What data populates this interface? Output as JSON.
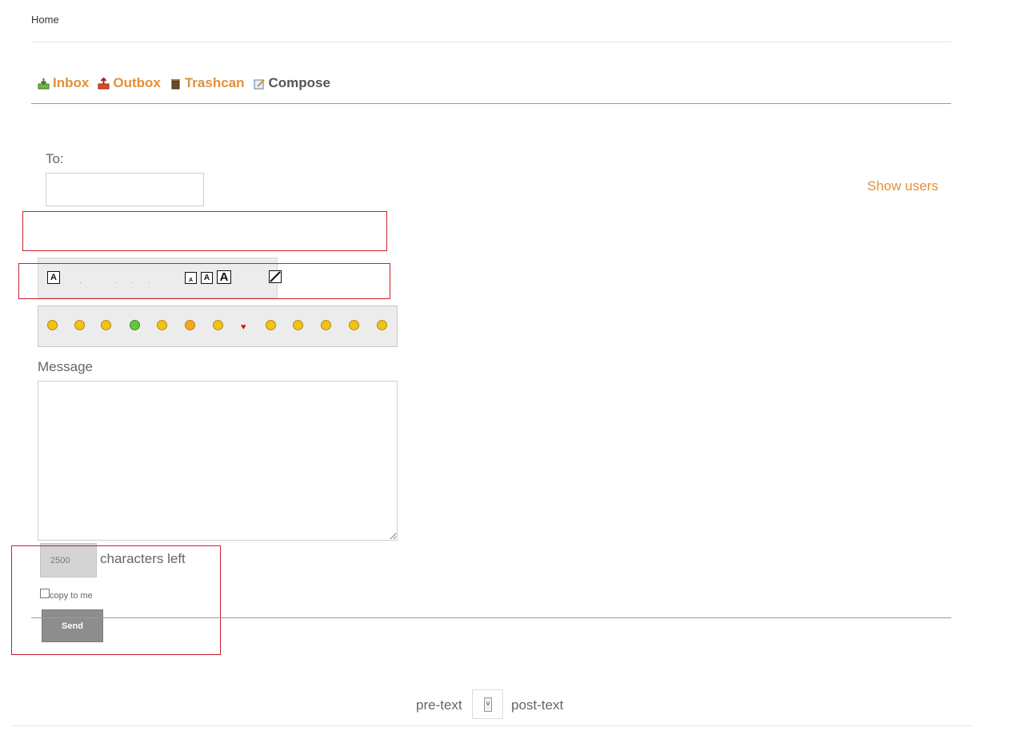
{
  "breadcrumb": "Home",
  "tabs": [
    {
      "label": "Inbox",
      "icon": "inbox-icon"
    },
    {
      "label": "Outbox",
      "icon": "outbox-icon"
    },
    {
      "label": "Trashcan",
      "icon": "trashcan-icon"
    },
    {
      "label": "Compose",
      "icon": "compose-icon"
    }
  ],
  "form": {
    "to_label": "To:",
    "to_value": "",
    "show_users": "Show users",
    "message_label": "Message",
    "message_value": "",
    "chars_count": "2500",
    "chars_left": "characters left",
    "copy_label": "copy to me",
    "send_label": "Send"
  },
  "format_toolbar": {
    "buttons": [
      "A",
      "A",
      "A",
      "A"
    ],
    "colors": {
      "link": "#e0913a",
      "error_outline": "#c8202c"
    }
  },
  "smileys": [
    "smile",
    "sad",
    "tongue",
    "sick",
    "angry",
    "surprised",
    "cool",
    "heart",
    "shocked",
    "grin",
    "scared",
    "wink",
    "confused"
  ],
  "pager": {
    "pre": "pre-text",
    "post": "post-text"
  }
}
